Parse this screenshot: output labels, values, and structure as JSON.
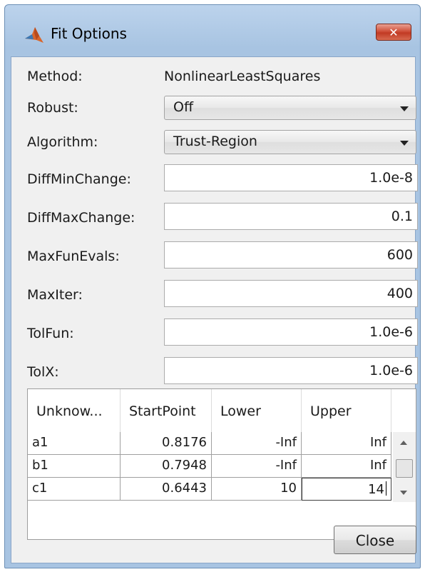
{
  "window": {
    "title": "Fit Options",
    "icon": "matlab-icon",
    "close_icon": "close-icon"
  },
  "form": {
    "method_label": "Method:",
    "method_value": "NonlinearLeastSquares",
    "robust_label": "Robust:",
    "robust_value": "Off",
    "algorithm_label": "Algorithm:",
    "algorithm_value": "Trust-Region",
    "diffminchange_label": "DiffMinChange:",
    "diffminchange_value": "1.0e-8",
    "diffmaxchange_label": "DiffMaxChange:",
    "diffmaxchange_value": "0.1",
    "maxfunevals_label": "MaxFunEvals:",
    "maxfunevals_value": "600",
    "maxiter_label": "MaxIter:",
    "maxiter_value": "400",
    "tolfun_label": "TolFun:",
    "tolfun_value": "1.0e-6",
    "tolx_label": "TolX:",
    "tolx_value": "1.0e-6"
  },
  "table": {
    "headers": [
      "Unknow...",
      "StartPoint",
      "Lower",
      "Upper"
    ],
    "rows": [
      {
        "name": "a1",
        "start": "0.8176",
        "lower": "-Inf",
        "upper": "Inf"
      },
      {
        "name": "b1",
        "start": "0.7948",
        "lower": "-Inf",
        "upper": "Inf"
      },
      {
        "name": "c1",
        "start": "0.6443",
        "lower": "10",
        "upper": "14"
      }
    ]
  },
  "buttons": {
    "close_label": "Close"
  },
  "colors": {
    "title_bar": "#a8c4e2",
    "close_x": "#c13a24",
    "panel": "#f0f0f0"
  }
}
